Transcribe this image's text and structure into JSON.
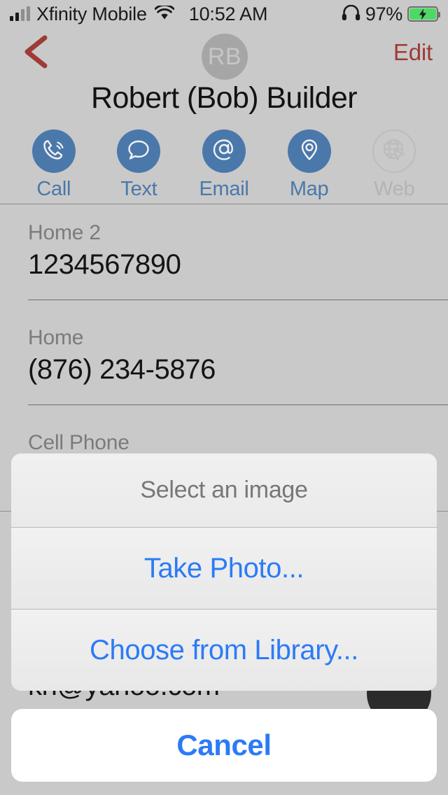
{
  "status_bar": {
    "carrier": "Xfinity Mobile",
    "time": "10:52 AM",
    "battery_percent": "97%",
    "wifi_icon": "wifi-icon",
    "signal_icon": "cellular-signal-icon",
    "headphones_icon": "headphones-icon",
    "battery_icon": "battery-charging-icon"
  },
  "nav_bar": {
    "back_icon": "back-chevron-icon",
    "avatar_initials": "RB",
    "edit_label": "Edit",
    "accent_color": "#9e3b36"
  },
  "contact": {
    "name": "Robert (Bob) Builder"
  },
  "actions": [
    {
      "label": "Call",
      "icon": "phone-icon",
      "enabled": true
    },
    {
      "label": "Text",
      "icon": "message-bubble-icon",
      "enabled": true
    },
    {
      "label": "Email",
      "icon": "at-sign-icon",
      "enabled": true
    },
    {
      "label": "Map",
      "icon": "map-pin-icon",
      "enabled": true
    },
    {
      "label": "Web",
      "icon": "globe-cursor-icon",
      "enabled": false
    }
  ],
  "fields": [
    {
      "label": "Home 2",
      "value": "1234567890"
    },
    {
      "label": "Home",
      "value": "(876) 234-5876"
    },
    {
      "label": "Cell Phone",
      "value": ""
    },
    {
      "label": "",
      "value": "kn@yahoo.com"
    }
  ],
  "action_sheet": {
    "title": "Select an image",
    "options": [
      {
        "label": "Take Photo..."
      },
      {
        "label": "Choose from Library..."
      }
    ],
    "cancel_label": "Cancel",
    "tint_color": "#2b7bf6"
  },
  "theme": {
    "background": "#c9c9c9",
    "action_blue": "#4a78ab",
    "disabled_gray": "#b4b4b4"
  }
}
